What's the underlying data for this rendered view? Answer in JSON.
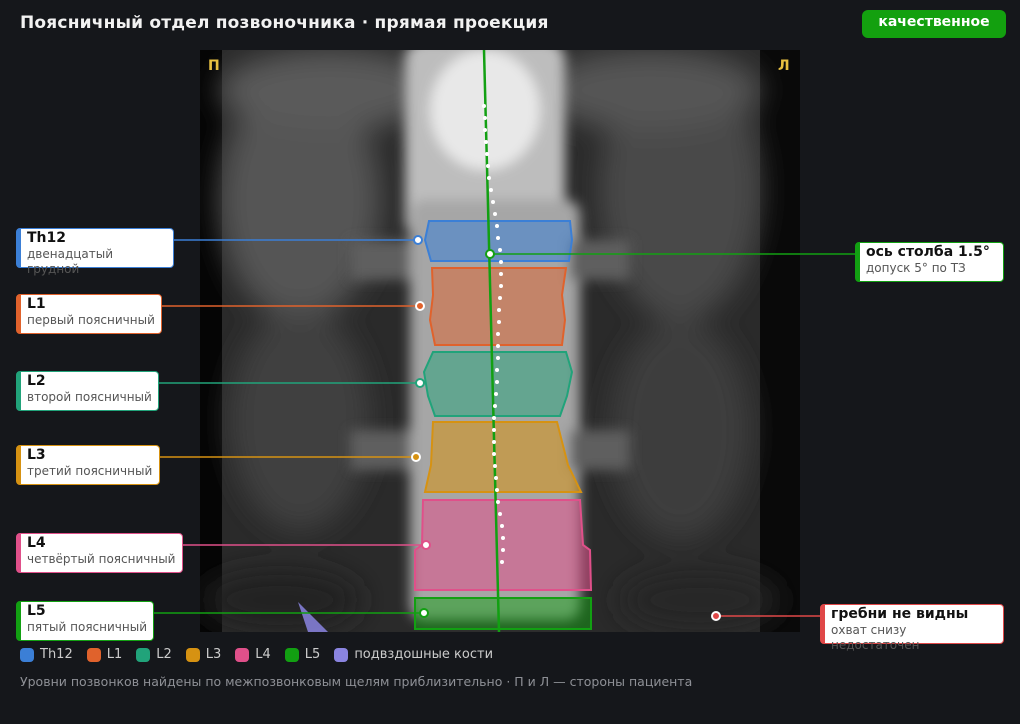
{
  "title": "Поясничный отдел позвоночника · прямая проекция",
  "badge": "качественное",
  "side_right_marker": "П",
  "side_left_marker": "Л",
  "vertebrae": [
    {
      "code": "Th12",
      "name": "двенадцатый грудной",
      "color": "#3b7fd6"
    },
    {
      "code": "L1",
      "name": "первый поясничный",
      "color": "#e0622c"
    },
    {
      "code": "L2",
      "name": "второй поясничный",
      "color": "#21a37a"
    },
    {
      "code": "L3",
      "name": "третий поясничный",
      "color": "#d69212"
    },
    {
      "code": "L4",
      "name": "четвёртый поясничный",
      "color": "#e0508a"
    },
    {
      "code": "L5",
      "name": "пятый поясничный",
      "color": "#12a012"
    }
  ],
  "axis_note": {
    "title": "ось столба 1.5°",
    "sub": "допуск 5° по ТЗ",
    "color": "#12a012"
  },
  "iliac_note": {
    "title": "гребни не видны",
    "sub": "охват снизу недостаточен",
    "color": "#e04848"
  },
  "legend": [
    {
      "label": "Th12",
      "color": "#3b7fd6"
    },
    {
      "label": "L1",
      "color": "#e0622c"
    },
    {
      "label": "L2",
      "color": "#21a37a"
    },
    {
      "label": "L3",
      "color": "#d69212"
    },
    {
      "label": "L4",
      "color": "#e0508a"
    },
    {
      "label": "L5",
      "color": "#12a012"
    },
    {
      "label": "подвздошные кости",
      "color": "#8a84e0"
    }
  ],
  "footnote": "Уровни позвонков найдены по межпозвонковым щелям приблизительно · П и Л — стороны пациента"
}
